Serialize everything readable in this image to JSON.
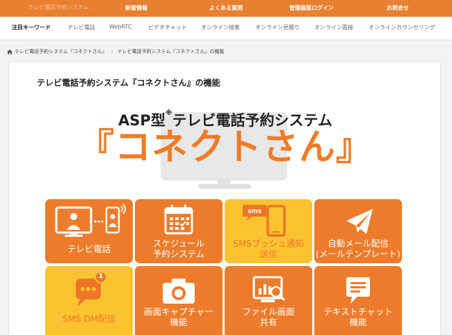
{
  "topbar": {
    "brand": "テレビ電話予約システム",
    "nav": [
      "新着情報",
      "よくある質問",
      "管理画面ログイン",
      "お問合せ"
    ]
  },
  "keywords": {
    "title": "注目キーワード",
    "items": [
      "テレビ電話",
      "WebRTC",
      "ビデオチャット",
      "オンライン接客",
      "オンライン見積り",
      "オンライン面接",
      "オンラインカウンセリング"
    ]
  },
  "breadcrumb": {
    "items": [
      "テレビ電話予約システム『コネクトさん』",
      "テレビ電話予約システム『コネクトさん』の機能"
    ]
  },
  "page": {
    "title": "テレビ電話予約システム『コネクトさん』の機能"
  },
  "hero": {
    "prefix": "ASP型",
    "mark": "※",
    "suffix": "テレビ電話予約システム",
    "product": "『コネクトさん』"
  },
  "features": [
    {
      "line1": "テレビ電話",
      "line2": "",
      "icon": "video-call-icon",
      "color": "orange"
    },
    {
      "line1": "スケジュール",
      "line2": "予約システム",
      "icon": "calendar-icon",
      "color": "orange"
    },
    {
      "line1": "SMSプッシュ通知",
      "line2": "送信",
      "icon": "sms-phone-icon",
      "color": "yellow"
    },
    {
      "line1": "自動メール配信",
      "line2": "(メールテンプレート)",
      "icon": "paper-plane-icon",
      "color": "orange"
    },
    {
      "line1": "SMS DM配信",
      "line2": "",
      "icon": "message-badge-icon",
      "color": "yellow",
      "badge": "1"
    },
    {
      "line1": "画面キャプチャー",
      "line2": "機能",
      "icon": "camera-icon",
      "color": "orange"
    },
    {
      "line1": "ファイル画面",
      "line2": "共有",
      "icon": "file-share-icon",
      "color": "orange"
    },
    {
      "line1": "テキストチャット",
      "line2": "機能",
      "icon": "chat-icon",
      "color": "orange"
    }
  ],
  "colors": {
    "accent": "#ec7c2b",
    "yellow": "#fcc330",
    "topbar": "#e8802f"
  }
}
